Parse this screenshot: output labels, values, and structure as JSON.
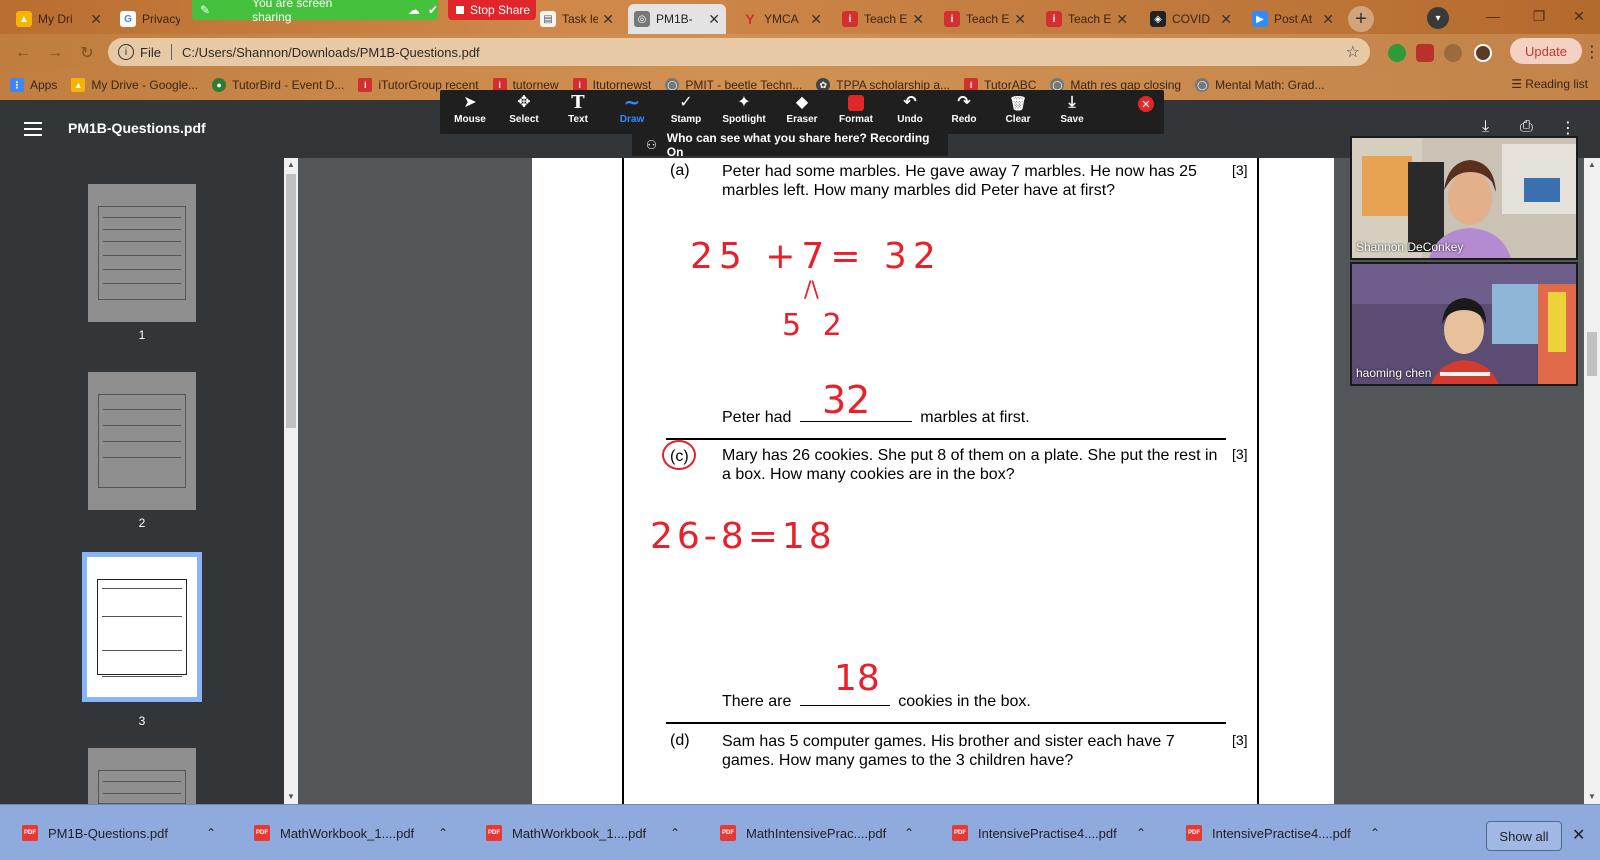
{
  "browser": {
    "tabs": [
      {
        "label": "My Dri",
        "icon": "drive-icon",
        "color": "#f4b400"
      },
      {
        "label": "Privacy",
        "icon": "google-icon",
        "color": "#4285f4"
      },
      {
        "label": "Task le",
        "icon": "doc-icon",
        "color": "#777777"
      },
      {
        "label": "PM1B-",
        "icon": "pdf-tab-icon",
        "color": "#555555",
        "active": true
      },
      {
        "label": "YMCA",
        "icon": "ymca-icon",
        "color": "#d32f2f"
      },
      {
        "label": "Teach E",
        "icon": "tutor-icon",
        "color": "#d32f2f"
      },
      {
        "label": "Teach E",
        "icon": "tutor-icon",
        "color": "#d32f2f"
      },
      {
        "label": "Teach E",
        "icon": "tutor-icon",
        "color": "#d32f2f"
      },
      {
        "label": "COVID",
        "icon": "shield-icon",
        "color": "#222222"
      },
      {
        "label": "Post At",
        "icon": "zoom-icon",
        "color": "#2d8cff"
      }
    ],
    "share_banner": "You are screen sharing",
    "stop_share": "Stop Share",
    "address": {
      "scheme": "File",
      "path": "C:/Users/Shannon/Downloads/PM1B-Questions.pdf"
    },
    "update_label": "Update",
    "bookmarks": [
      {
        "label": "Apps",
        "icon": "apps-icon",
        "color": "#4285f4"
      },
      {
        "label": "My Drive - Google...",
        "icon": "drive-icon",
        "color": "#f4b400"
      },
      {
        "label": "TutorBird - Event D...",
        "icon": "tutorbird-icon",
        "color": "#2e7d32"
      },
      {
        "label": "iTutorGroup recent",
        "icon": "tutor-icon",
        "color": "#d32f2f"
      },
      {
        "label": "tutornew",
        "icon": "tutor-icon",
        "color": "#d32f2f"
      },
      {
        "label": "Itutornewst",
        "icon": "tutor-icon",
        "color": "#d32f2f"
      },
      {
        "label": "PMIT - beetle Techn...",
        "icon": "globe-icon",
        "color": "#666666"
      },
      {
        "label": "TPPA scholarship a...",
        "icon": "tppa-icon",
        "color": "#444444"
      },
      {
        "label": "TutorABC",
        "icon": "tutor-icon",
        "color": "#d32f2f"
      },
      {
        "label": "Math res gap closing",
        "icon": "globe-icon",
        "color": "#666666"
      },
      {
        "label": "Mental Math: Grad...",
        "icon": "globe-icon",
        "color": "#666666"
      }
    ],
    "reading_list": "Reading list"
  },
  "pdf_viewer": {
    "title": "PM1B-Questions.pdf",
    "thumbnails": [
      {
        "number": "1"
      },
      {
        "number": "2"
      },
      {
        "number": "3",
        "active": true
      }
    ]
  },
  "annotation_toolbar": {
    "tools": [
      {
        "label": "Mouse",
        "icon": "mouse-pointer-icon",
        "glyph": "➤"
      },
      {
        "label": "Select",
        "icon": "move-icon",
        "glyph": "✥"
      },
      {
        "label": "Text",
        "icon": "text-icon",
        "glyph": "T"
      },
      {
        "label": "Draw",
        "icon": "draw-icon",
        "glyph": "∼",
        "active": true
      },
      {
        "label": "Stamp",
        "icon": "stamp-check-icon",
        "glyph": "✓"
      },
      {
        "label": "Spotlight",
        "icon": "spotlight-icon",
        "glyph": "✦"
      },
      {
        "label": "Eraser",
        "icon": "eraser-icon",
        "glyph": "◆"
      },
      {
        "label": "Format",
        "icon": "format-color-icon",
        "glyph": ""
      },
      {
        "label": "Undo",
        "icon": "undo-icon",
        "glyph": "↶"
      },
      {
        "label": "Redo",
        "icon": "redo-icon",
        "glyph": "↷"
      },
      {
        "label": "Clear",
        "icon": "trash-icon",
        "glyph": "🗑"
      },
      {
        "label": "Save",
        "icon": "save-icon",
        "glyph": "⤓"
      }
    ],
    "recording_notice": "Who can see what you share here? Recording On"
  },
  "document": {
    "q_a": {
      "label": "(a)",
      "text": "Peter had some marbles. He gave away 7 marbles. He now has 25 marbles left. How many marbles did Peter have at first?",
      "marks": "[3]",
      "answer_prefix": "Peter had",
      "answer_suffix": "marbles at first."
    },
    "q_c": {
      "label": "(c)",
      "text": "Mary has 26 cookies.  She put 8 of them on a plate.  She put the rest in a box.  How many cookies are in the box?",
      "marks": "[3]",
      "answer_prefix": "There are",
      "answer_suffix": "cookies in the box."
    },
    "q_d": {
      "label": "(d)",
      "text": "Sam has 5 computer games. His brother and sister each have 7 games. How many games to the 3 children have?",
      "marks": "[3]"
    },
    "handwriting": {
      "eq_a": "25 +7= 32",
      "split_a": "5  2",
      "ans_a": "32",
      "eq_c": "26-8=18",
      "ans_c": "18",
      "ink_color": "#e8202a"
    }
  },
  "participants": [
    {
      "name": "Shannon DeConkey"
    },
    {
      "name": "haoming   chen"
    }
  ],
  "downloads": {
    "items": [
      {
        "label": "PM1B-Questions.pdf"
      },
      {
        "label": "MathWorkbook_1....pdf"
      },
      {
        "label": "MathWorkbook_1....pdf"
      },
      {
        "label": "MathIntensivePrac....pdf"
      },
      {
        "label": "IntensivePractise4....pdf"
      },
      {
        "label": "IntensivePractise4....pdf"
      }
    ],
    "show_all": "Show all"
  }
}
